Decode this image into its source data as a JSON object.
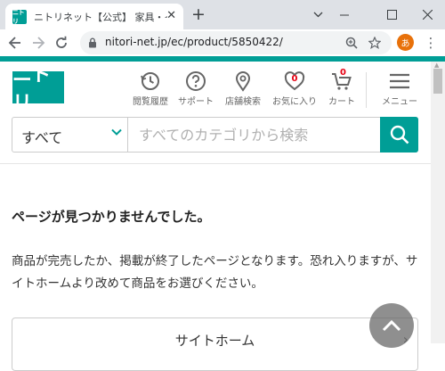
{
  "browser": {
    "tab": {
      "title": "ニトリネット【公式】 家具・インテリア",
      "favicon_text": "ニトリ"
    },
    "url": "nitori-net.jp/ec/product/5850422/",
    "profile_initial": "あ"
  },
  "site": {
    "logo_text": "ニトリ",
    "brand_color": "#009e96",
    "nav": [
      {
        "label": "閲覧履歴",
        "icon": "history-icon"
      },
      {
        "label": "サポート",
        "icon": "help-icon"
      },
      {
        "label": "店舗検索",
        "icon": "location-pin-icon"
      },
      {
        "label": "お気に入り",
        "icon": "heart-icon",
        "badge": "0"
      },
      {
        "label": "カート",
        "icon": "cart-icon",
        "badge": "0"
      },
      {
        "label": "メニュー",
        "icon": "hamburger-icon"
      }
    ]
  },
  "search": {
    "category_selected": "すべて",
    "placeholder": "すべてのカテゴリから検索"
  },
  "error": {
    "heading": "ページが見つかりませんでした。",
    "body": "商品が完売したか、掲載が終了したページとなります。恐れ入りますが、サイトホームより改めて商品をお選びください。"
  },
  "home_link": {
    "label": "サイトホーム"
  }
}
